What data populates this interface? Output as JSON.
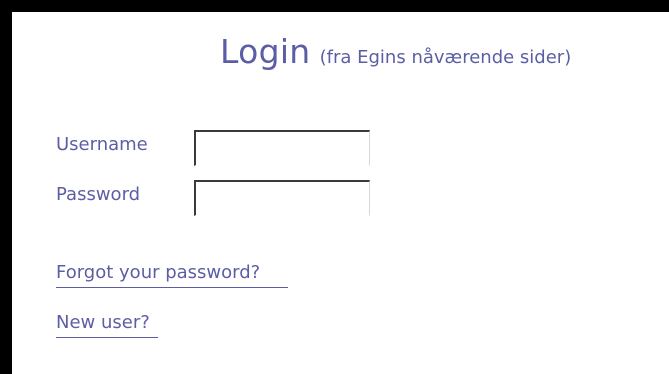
{
  "login": {
    "title": "Login",
    "subtitle": "(fra Egins nåværende sider)",
    "username_label": "Username",
    "username_value": "",
    "password_label": "Password",
    "password_value": "",
    "forgot_link": "Forgot your password?",
    "new_user_link": "New user?"
  },
  "colors": {
    "accent": "#5c5ea5",
    "frame_border": "#000000",
    "background": "#ffffff"
  }
}
